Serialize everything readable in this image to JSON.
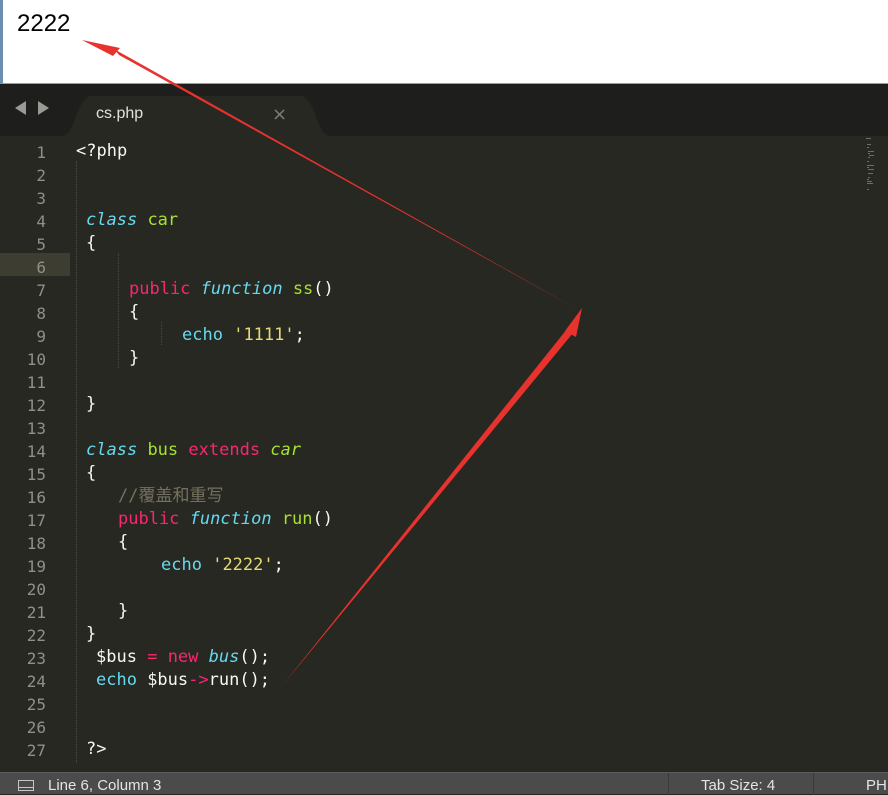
{
  "output": {
    "text": "2222"
  },
  "tabs": [
    {
      "label": "cs.php",
      "close": "×"
    }
  ],
  "editor": {
    "line_numbers": [
      "1",
      "2",
      "3",
      "4",
      "5",
      "6",
      "7",
      "8",
      "9",
      "10",
      "11",
      "12",
      "13",
      "14",
      "15",
      "16",
      "17",
      "18",
      "19",
      "20",
      "21",
      "22",
      "23",
      "24",
      "25",
      "26",
      "27"
    ],
    "current_line": 6
  },
  "status_bar": {
    "position": "Line 6, Column 3",
    "tab_size": "Tab Size: 4",
    "syntax": "PHP"
  },
  "colors": {
    "editor_bg": "#272822",
    "keyword": "#f92672",
    "string": "#e6db74",
    "storage_type": "#66d9ef",
    "entity": "#a6e22e",
    "comment": "#75715e",
    "annotation_arrow": "#e8322e"
  },
  "icons": {
    "nav_back": "chevron-left-icon",
    "nav_forward": "chevron-right-icon",
    "tab_close": "close-icon",
    "status_panel": "panel-toggle-icon"
  }
}
